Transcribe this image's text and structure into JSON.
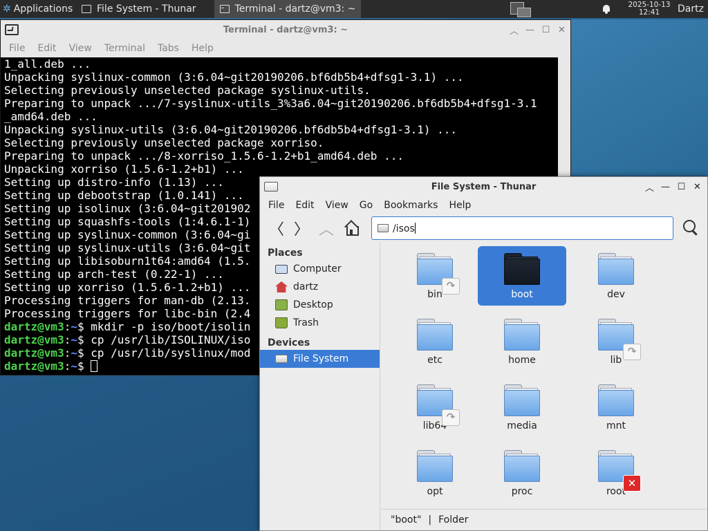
{
  "panel": {
    "apps_label": "Applications",
    "apps_tail": "≡",
    "tasks": [
      {
        "label": "File System - Thunar",
        "icon": "folder-window-icon"
      },
      {
        "label": "Terminal - dartz@vm3: ~",
        "icon": "terminal-window-icon"
      }
    ],
    "date": "2025-10-13",
    "time": "12:41",
    "user": "Dartz"
  },
  "terminal": {
    "title": "Terminal - dartz@vm3: ~",
    "menu": [
      "File",
      "Edit",
      "View",
      "Terminal",
      "Tabs",
      "Help"
    ],
    "lines": [
      "1_all.deb ...",
      "Unpacking syslinux-common (3:6.04~git20190206.bf6db5b4+dfsg1-3.1) ...",
      "Selecting previously unselected package syslinux-utils.",
      "Preparing to unpack .../7-syslinux-utils_3%3a6.04~git20190206.bf6db5b4+dfsg1-3.1",
      "_amd64.deb ...",
      "Unpacking syslinux-utils (3:6.04~git20190206.bf6db5b4+dfsg1-3.1) ...",
      "Selecting previously unselected package xorriso.",
      "Preparing to unpack .../8-xorriso_1.5.6-1.2+b1_amd64.deb ...",
      "Unpacking xorriso (1.5.6-1.2+b1) ...",
      "Setting up distro-info (1.13) ...",
      "Setting up debootstrap (1.0.141) ...",
      "Setting up isolinux (3:6.04~git201902",
      "Setting up squashfs-tools (1:4.6.1-1)",
      "Setting up syslinux-common (3:6.04~gi",
      "Setting up syslinux-utils (3:6.04~git",
      "Setting up libisoburn1t64:amd64 (1.5.",
      "Setting up arch-test (0.22-1) ...",
      "Setting up xorriso (1.5.6-1.2+b1) ...",
      "Processing triggers for man-db (2.13.",
      "Processing triggers for libc-bin (2.4"
    ],
    "prompt_user": "dartz@vm3",
    "prompt_path": "~",
    "commands": [
      "mkdir -p iso/boot/isolin",
      "cp /usr/lib/ISOLINUX/iso",
      "cp /usr/lib/syslinux/mod",
      ""
    ]
  },
  "thunar": {
    "title": "File System - Thunar",
    "menu": [
      "File",
      "Edit",
      "View",
      "Go",
      "Bookmarks",
      "Help"
    ],
    "location": "/isos",
    "places_heading": "Places",
    "places": [
      {
        "label": "Computer",
        "icon": "computer-icon"
      },
      {
        "label": "dartz",
        "icon": "user-home-icon"
      },
      {
        "label": "Desktop",
        "icon": "desktop-icon"
      },
      {
        "label": "Trash",
        "icon": "trash-icon"
      }
    ],
    "devices_heading": "Devices",
    "devices": [
      {
        "label": "File System",
        "icon": "drive-icon",
        "selected": true
      }
    ],
    "items": [
      {
        "name": "bin",
        "emblem": "symlink"
      },
      {
        "name": "boot",
        "selected": true
      },
      {
        "name": "dev"
      },
      {
        "name": "etc"
      },
      {
        "name": "home"
      },
      {
        "name": "lib",
        "emblem": "symlink"
      },
      {
        "name": "lib64",
        "emblem": "symlink"
      },
      {
        "name": "media"
      },
      {
        "name": "mnt"
      },
      {
        "name": "opt"
      },
      {
        "name": "proc"
      },
      {
        "name": "root",
        "emblem": "no-access"
      }
    ],
    "status_name": "\"boot\"",
    "status_sep": "|",
    "status_type": "Folder"
  },
  "colors": {
    "selection": "#3a7bd5",
    "prompt_user": "#4cd24c",
    "prompt_path": "#5b8cff",
    "panel": "#2b2b2b"
  }
}
